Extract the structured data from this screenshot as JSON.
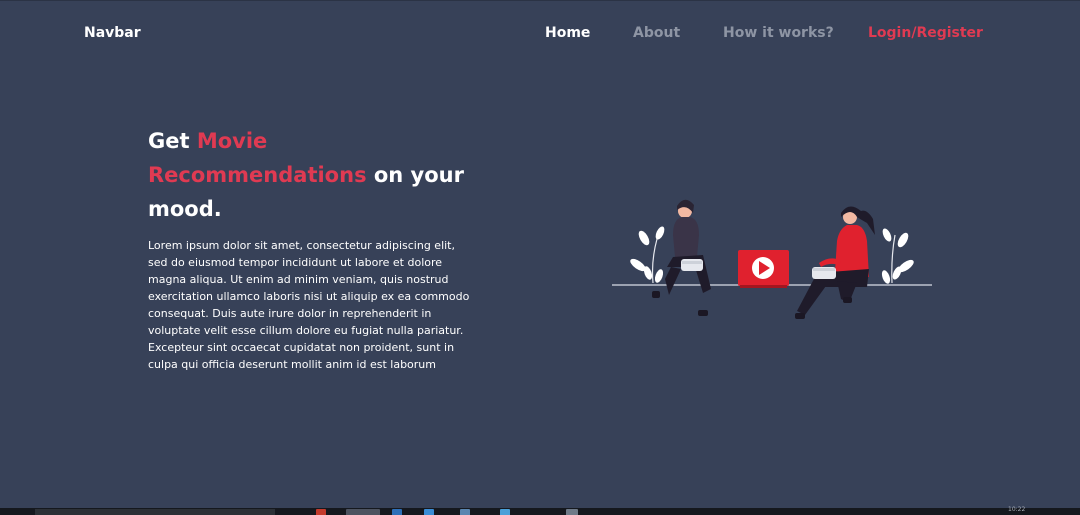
{
  "navbar": {
    "brand": "Navbar",
    "links": [
      {
        "label": "Home"
      },
      {
        "label": "About"
      },
      {
        "label": "How it works?"
      },
      {
        "label": "Login/Register"
      }
    ]
  },
  "hero": {
    "title_part1": "Get ",
    "title_highlight": "Movie Recommendations",
    "title_part2": " on your mood.",
    "body": "Lorem ipsum dolor sit amet, consectetur adipiscing elit, sed do eiusmod tempor incididunt ut labore et dolore magna aliqua. Ut enim ad minim veniam, quis nostrud exercitation ullamco laboris nisi ut aliquip ex ea commodo consequat. Duis aute irure dolor in reprehenderit in voluptate velit esse cillum dolore eu fugiat nulla pariatur. Excepteur sint occaecat cupidatat non proident, sunt in culpa qui officia deserunt mollit anim id est laborum"
  },
  "illustration": {
    "icon": "play-button-icon"
  },
  "colors": {
    "background": "#374158",
    "accent": "#e03a52",
    "nav_inactive": "#8e95a4",
    "text": "#ffffff"
  },
  "taskbar": {
    "clock": "10:22"
  }
}
